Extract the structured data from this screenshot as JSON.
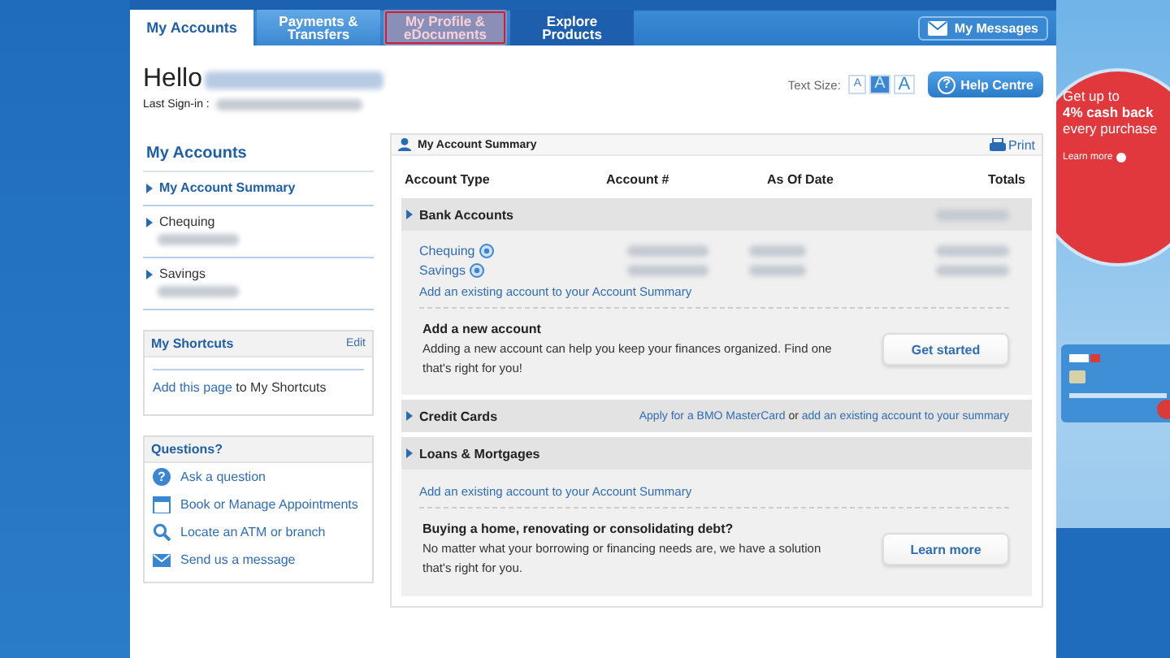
{
  "nav": {
    "tabs": [
      {
        "label": "My Accounts",
        "selected": true,
        "highlighted": false
      },
      {
        "label": "Payments & Transfers",
        "selected": false,
        "highlighted": false
      },
      {
        "label": "My Profile & eDocuments",
        "selected": false,
        "highlighted": true
      },
      {
        "label": "Explore Products",
        "selected": false,
        "highlighted": false
      }
    ],
    "messages_button": "My Messages"
  },
  "header": {
    "greeting": "Hello",
    "last_sign_in_label": "Last Sign-in :",
    "text_size_label": "Text Size:",
    "text_sizes": [
      {
        "label": "A",
        "selected": false
      },
      {
        "label": "A",
        "selected": true
      },
      {
        "label": "A",
        "selected": false
      }
    ],
    "help_icon": "?",
    "help_button": "Help Centre"
  },
  "sidebar": {
    "title": "My Accounts",
    "items": [
      {
        "label": "My Account Summary",
        "selected": true,
        "has_number": false
      },
      {
        "label": "Chequing",
        "selected": false,
        "has_number": true
      },
      {
        "label": "Savings",
        "selected": false,
        "has_number": true
      }
    ],
    "shortcuts": {
      "title": "My Shortcuts",
      "edit": "Edit",
      "link": "Add this page",
      "text": " to My Shortcuts"
    },
    "questions": {
      "title": "Questions?",
      "items": [
        {
          "kind": "question",
          "icon": "?",
          "label": "Ask a question"
        },
        {
          "kind": "calendar",
          "label": "Book or Manage Appointments"
        },
        {
          "kind": "search",
          "label": "Locate an ATM or branch"
        },
        {
          "kind": "mail",
          "label": "Send us a message"
        }
      ]
    }
  },
  "summary": {
    "title": "My Account Summary",
    "print": "Print",
    "columns": [
      "Account Type",
      "Account #",
      "As Of Date",
      "Totals"
    ],
    "sections": [
      {
        "title": "Bank Accounts",
        "expanded": true,
        "has_total": true,
        "accounts": [
          {
            "name": "Chequing"
          },
          {
            "name": "Savings"
          }
        ],
        "add_link": "Add an existing account to your Account Summary",
        "promo": {
          "title": "Add a new account",
          "text": "Adding a new account can help you keep your finances organized. Find one that's right for you!",
          "button": "Get started"
        }
      },
      {
        "title": "Credit Cards",
        "expanded": false,
        "has_total": false,
        "links": [
          {
            "kind": "link",
            "text": "Apply for a BMO MasterCard"
          },
          {
            "kind": "text",
            "text": " or "
          },
          {
            "kind": "link",
            "text": "add an existing account to your summary"
          }
        ]
      },
      {
        "title": "Loans & Mortgages",
        "expanded": true,
        "has_total": false,
        "add_link": "Add an existing account to your Account Summary",
        "promo": {
          "title": "Buying a home, renovating or consolidating debt?",
          "text": "No matter what your borrowing or financing needs are, we have a solution that's right for you.",
          "button": "Learn more"
        }
      }
    ]
  },
  "ad": {
    "lines": [
      "Get up to",
      "4% cash back",
      "every purchase"
    ],
    "link": "Learn more"
  }
}
